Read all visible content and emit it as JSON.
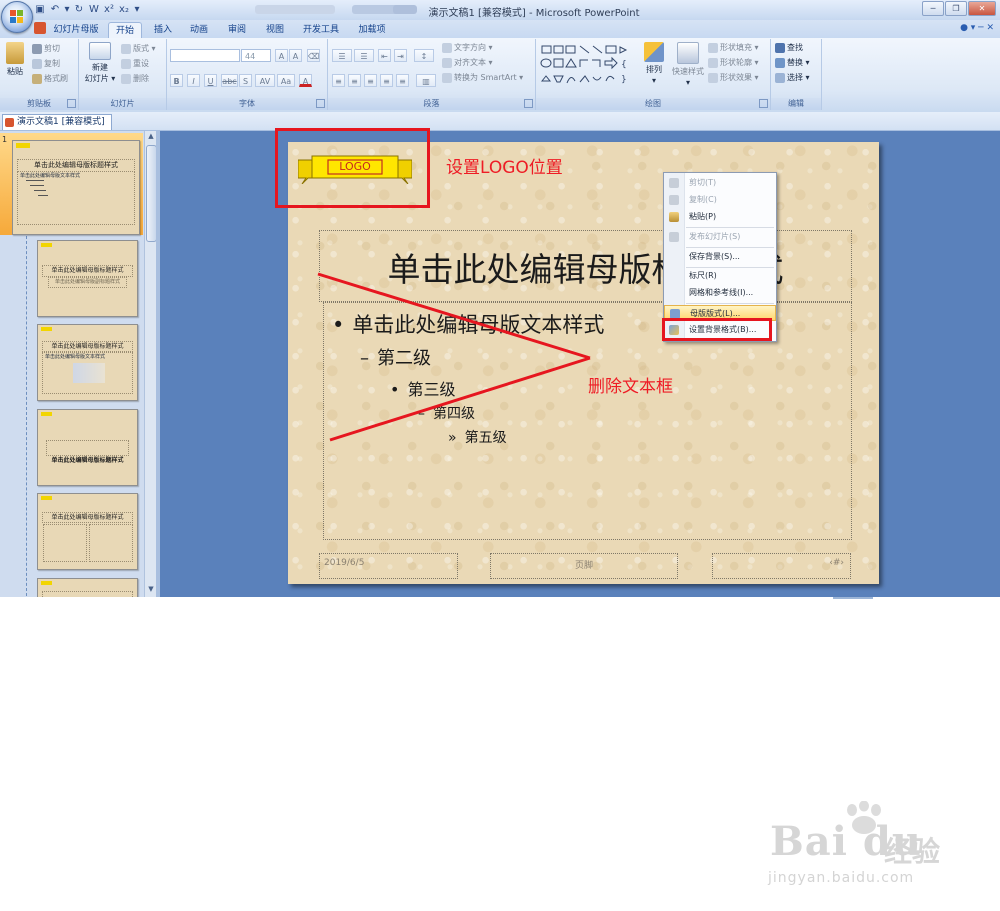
{
  "window": {
    "title": "演示文稿1 [兼容模式] - Microsoft PowerPoint"
  },
  "ribbon_tabs": [
    {
      "label": "幻灯片母版"
    },
    {
      "label": "开始"
    },
    {
      "label": "插入"
    },
    {
      "label": "动画"
    },
    {
      "label": "审阅"
    },
    {
      "label": "视图"
    },
    {
      "label": "开发工具"
    },
    {
      "label": "加载项"
    }
  ],
  "active_tab": "开始",
  "ribbon": {
    "clipboard": {
      "label": "剪贴板",
      "paste": "粘贴",
      "cut": "剪切",
      "copy": "复制",
      "format_painter": "格式刷"
    },
    "slides": {
      "label": "幻灯片",
      "new_slide_1": "新建",
      "new_slide_2": "幻灯片 ▾",
      "layout": "版式 ▾",
      "reset": "重设",
      "delete": "删除"
    },
    "font": {
      "label": "字体",
      "font_name": "",
      "font_size": "44",
      "bold": "B",
      "italic": "I",
      "underline": "U",
      "strike": "abc",
      "shadow": "S",
      "spacing": "AV",
      "case": "Aa",
      "color": "A",
      "grow": "A",
      "shrink": "A"
    },
    "paragraph": {
      "label": "段落",
      "text_direction": "文字方向 ▾",
      "align_text": "对齐文本 ▾",
      "smartart": "转换为 SmartArt ▾"
    },
    "drawing": {
      "label": "绘图",
      "arrange": "排列",
      "quick_styles": "快速样式",
      "shape_fill": "形状填充 ▾",
      "shape_outline": "形状轮廓 ▾",
      "shape_effects": "形状效果 ▾"
    },
    "editing": {
      "label": "编辑",
      "find": "查找",
      "replace": "替换 ▾",
      "select": "选择 ▾"
    }
  },
  "document_tab": "演示文稿1 [兼容模式]",
  "thumbnails": {
    "selected_index": "1",
    "items": [
      {
        "title": "单击此处编辑母版标题样式",
        "body": "单击此处编辑母版文本样式"
      },
      {
        "title": "单击此处编辑母版标题样式",
        "body": "单击此处编辑母版副标题样式"
      },
      {
        "title": "单击此处编辑母版标题样式",
        "body": "单击此处编辑母版文本样式"
      },
      {
        "title": "单击此处编辑母版标题样式",
        "body": ""
      },
      {
        "title": "单击此处编辑母版标题样式",
        "body": ""
      },
      {
        "title": "",
        "body": ""
      }
    ]
  },
  "slide": {
    "logo_text": "LOGO",
    "title": "单击此处编辑母版标题样式",
    "levels": [
      {
        "bullet": "•",
        "text": "单击此处编辑母版文本样式"
      },
      {
        "bullet": "–",
        "text": "第二级"
      },
      {
        "bullet": "•",
        "text": "第三级"
      },
      {
        "bullet": "–",
        "text": "第四级"
      },
      {
        "bullet": "»",
        "text": "第五级"
      }
    ],
    "footer_date": "2019/6/5",
    "footer_center": "页脚",
    "footer_number": "‹#›"
  },
  "annotations": {
    "logo_note": "设置LOGO位置",
    "delete_note": "删除文本框",
    "color": "#ee1c25"
  },
  "context_menu": {
    "items": [
      {
        "label": "剪切(T)",
        "enabled": false
      },
      {
        "label": "复制(C)",
        "enabled": false
      },
      {
        "label": "粘贴(P)",
        "enabled": true
      },
      {
        "label": "发布幻灯片(S)",
        "enabled": false
      },
      {
        "label": "保存背景(S)...",
        "enabled": true
      },
      {
        "label": "标尺(R)",
        "enabled": true
      },
      {
        "label": "网格和参考线(I)...",
        "enabled": true
      },
      {
        "label": "母版版式(L)...",
        "enabled": true
      },
      {
        "label": "设置背景格式(B)...",
        "enabled": true
      }
    ],
    "highlighted": "设置背景格式(B)..."
  },
  "watermark": {
    "brand": "Bai du",
    "brand_cn": "经验",
    "url": "jingyan.baidu.com"
  }
}
